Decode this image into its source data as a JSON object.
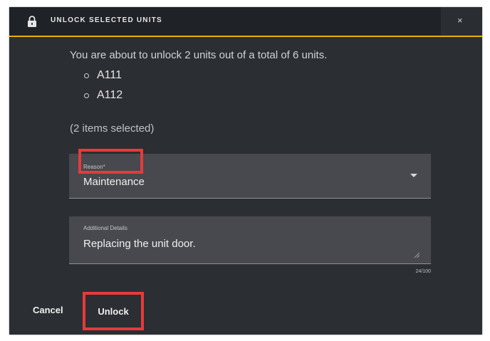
{
  "dialog": {
    "title": "UNLOCK SELECTED UNITS",
    "close_label": "×",
    "intro_text": "You are about to unlock 2 units out of a total of 6 units.",
    "units": [
      "A111",
      "A112"
    ],
    "selected_count_text": "(2 items selected)"
  },
  "form": {
    "reason": {
      "label": "Reason*",
      "value": "Maintenance"
    },
    "details": {
      "label": "Additional Details",
      "value": "Replacing the unit door.",
      "counter": "24/100"
    }
  },
  "actions": {
    "cancel_label": "Cancel",
    "unlock_label": "Unlock"
  },
  "colors": {
    "accent": "#e8b100",
    "highlight": "#e73a3a",
    "dialog_bg": "#2b2e33",
    "titlebar_bg": "#1f2227"
  }
}
